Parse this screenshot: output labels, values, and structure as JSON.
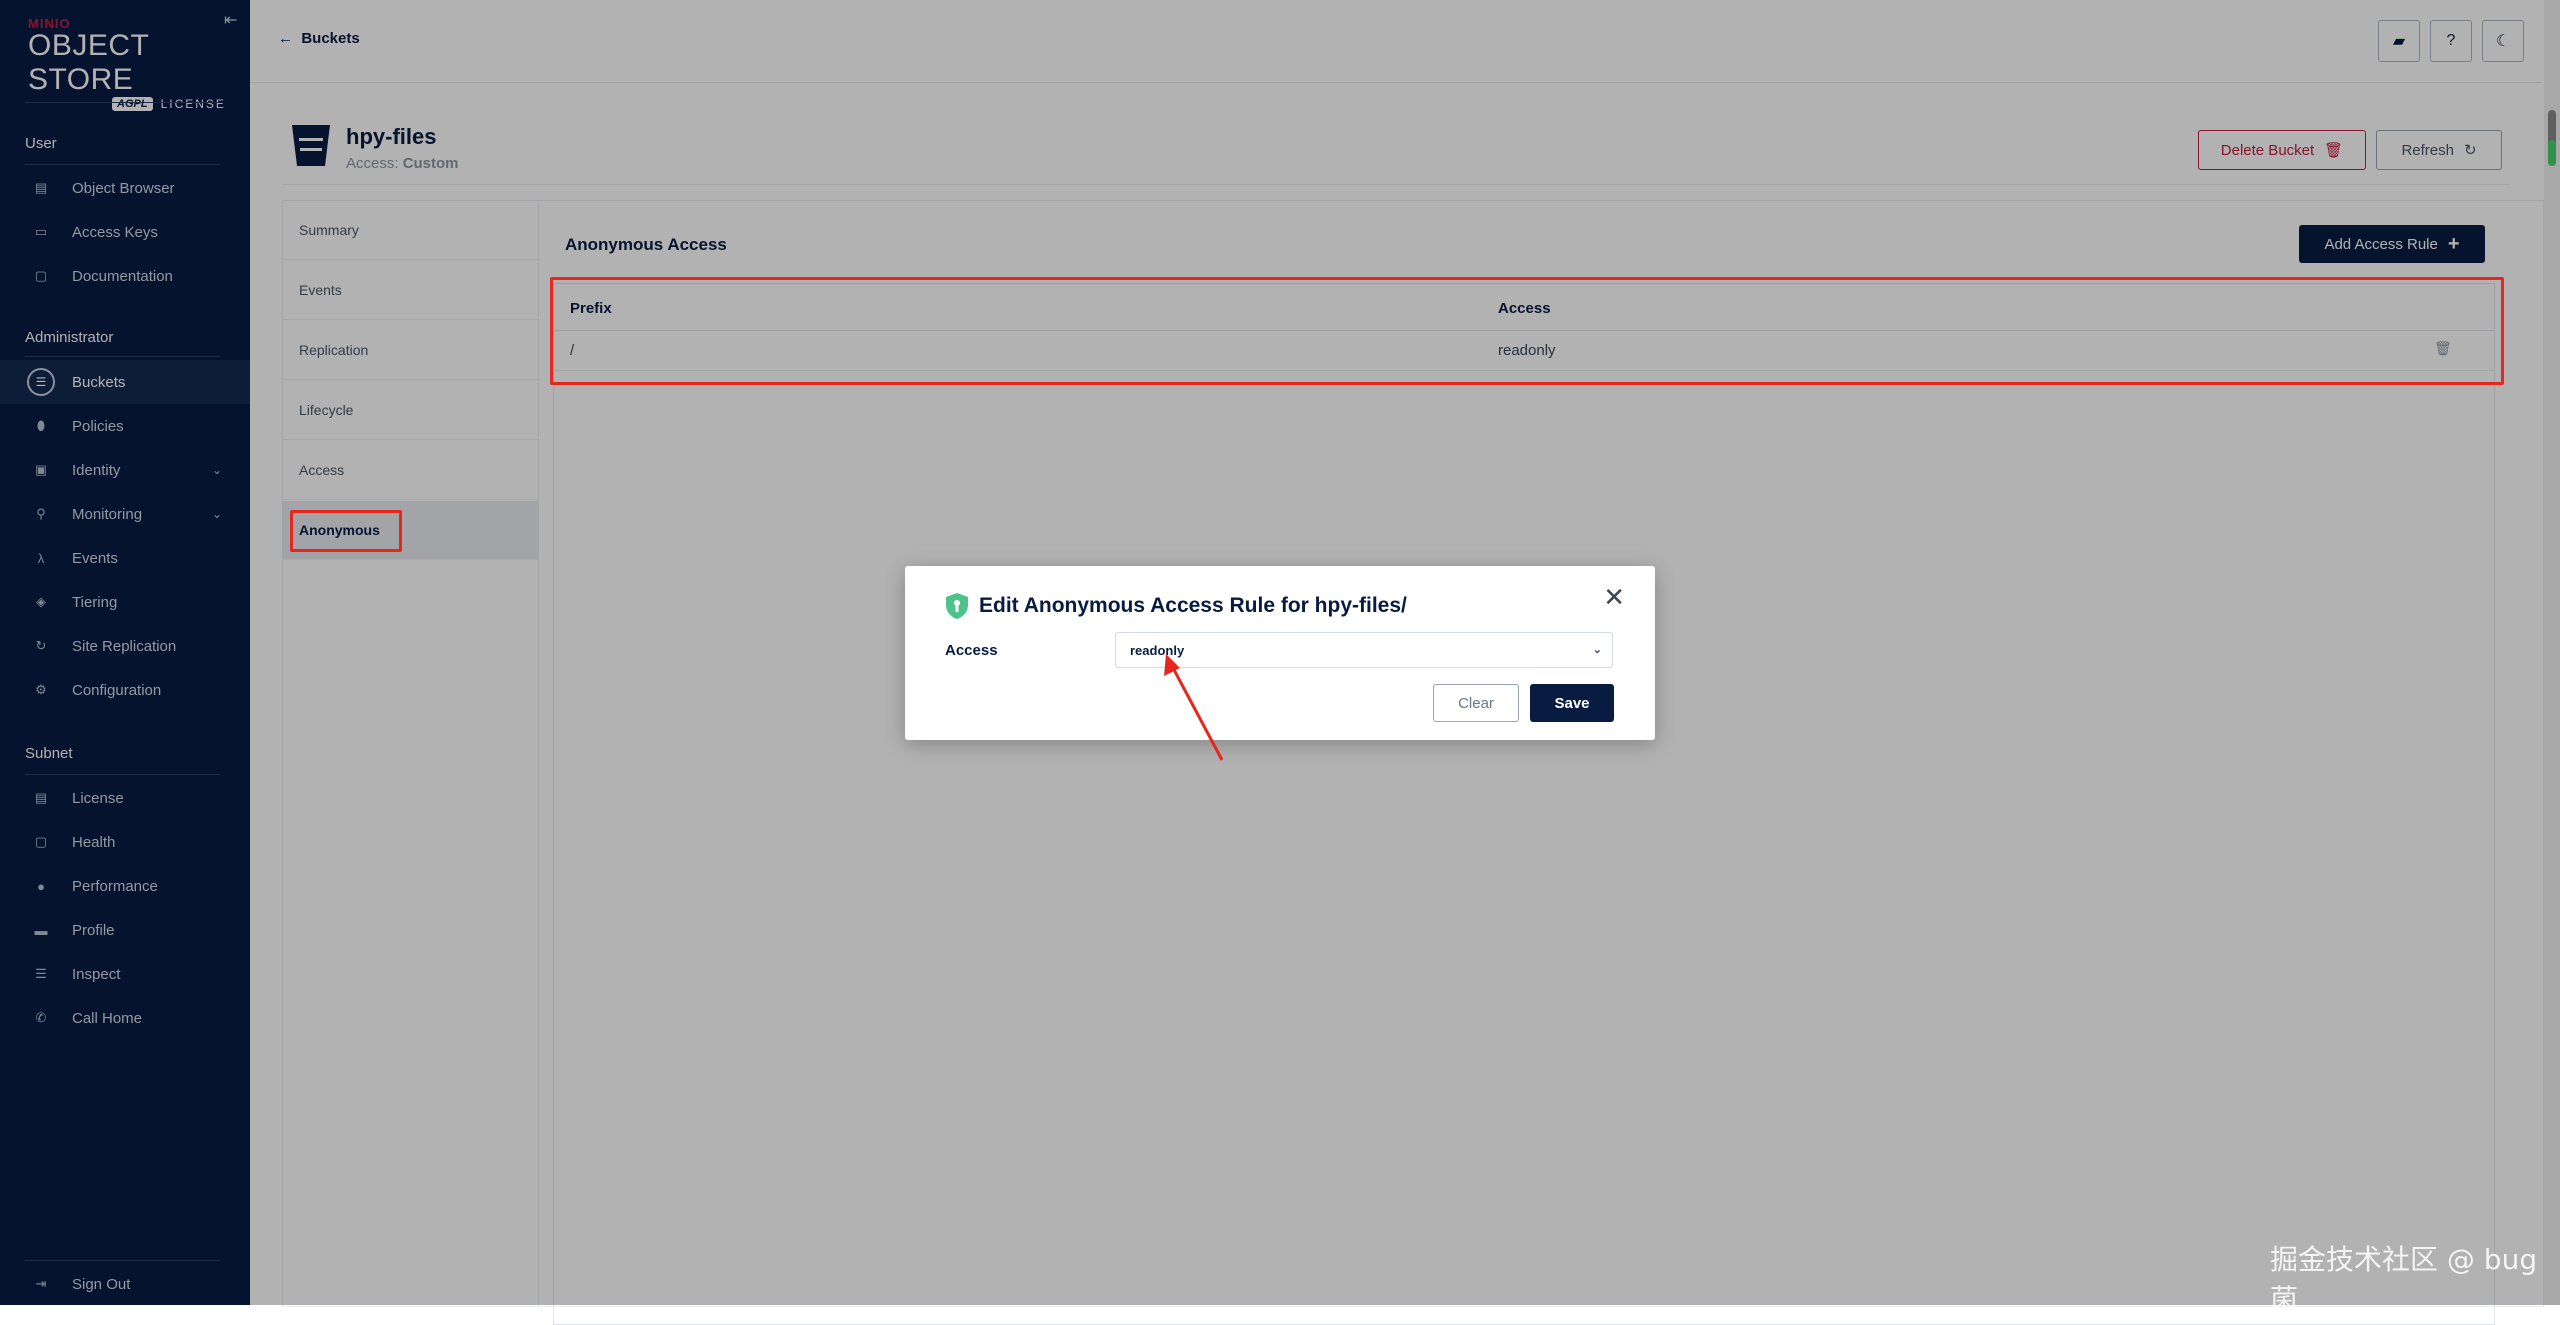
{
  "logo": {
    "brand": "MINIO",
    "product": "OBJECT STORE",
    "edition": "AGPL",
    "license": "LICENSE"
  },
  "sidebar": {
    "sections": [
      {
        "label": "User",
        "items": [
          {
            "label": "Object Browser",
            "icon": "object-browser-icon"
          },
          {
            "label": "Access Keys",
            "icon": "key-icon"
          },
          {
            "label": "Documentation",
            "icon": "document-icon"
          }
        ]
      },
      {
        "label": "Administrator",
        "items": [
          {
            "label": "Buckets",
            "icon": "bucket-icon"
          },
          {
            "label": "Policies",
            "icon": "shield-icon"
          },
          {
            "label": "Identity",
            "icon": "identity-icon"
          },
          {
            "label": "Monitoring",
            "icon": "search-icon"
          },
          {
            "label": "Events",
            "icon": "lambda-icon"
          },
          {
            "label": "Tiering",
            "icon": "tiers-icon"
          },
          {
            "label": "Site Replication",
            "icon": "replication-icon"
          },
          {
            "label": "Configuration",
            "icon": "gear-icon"
          }
        ]
      },
      {
        "label": "Subnet",
        "items": [
          {
            "label": "License",
            "icon": "license-icon"
          },
          {
            "label": "Health",
            "icon": "health-icon"
          },
          {
            "label": "Performance",
            "icon": "speedometer-icon"
          },
          {
            "label": "Profile",
            "icon": "profile-icon"
          },
          {
            "label": "Inspect",
            "icon": "inspect-icon"
          },
          {
            "label": "Call Home",
            "icon": "phone-icon"
          }
        ]
      }
    ],
    "sign_out": "Sign Out"
  },
  "topbar": {
    "back_label": "Buckets"
  },
  "bucket": {
    "name": "hpy-files",
    "access_prefix": "Access:",
    "access_value": "Custom",
    "delete_label": "Delete Bucket",
    "refresh_label": "Refresh"
  },
  "tabs": [
    "Summary",
    "Events",
    "Replication",
    "Lifecycle",
    "Access",
    "Anonymous"
  ],
  "active_tab": "Anonymous",
  "content": {
    "title": "Anonymous Access",
    "add_label": "Add Access Rule",
    "columns": {
      "prefix": "Prefix",
      "access": "Access"
    },
    "rows": [
      {
        "prefix": "/",
        "access": "readonly"
      }
    ]
  },
  "modal": {
    "title": "Edit Anonymous Access Rule for hpy-files/",
    "field_label": "Access",
    "selected_value": "readonly",
    "clear_label": "Clear",
    "save_label": "Save"
  },
  "watermark": "掘金技术社区 @ bug菌",
  "colors": {
    "brand_navy": "#081c42",
    "danger": "#c51b3f",
    "annotation_red": "#e5271e",
    "shield_green": "#4cc38a"
  }
}
